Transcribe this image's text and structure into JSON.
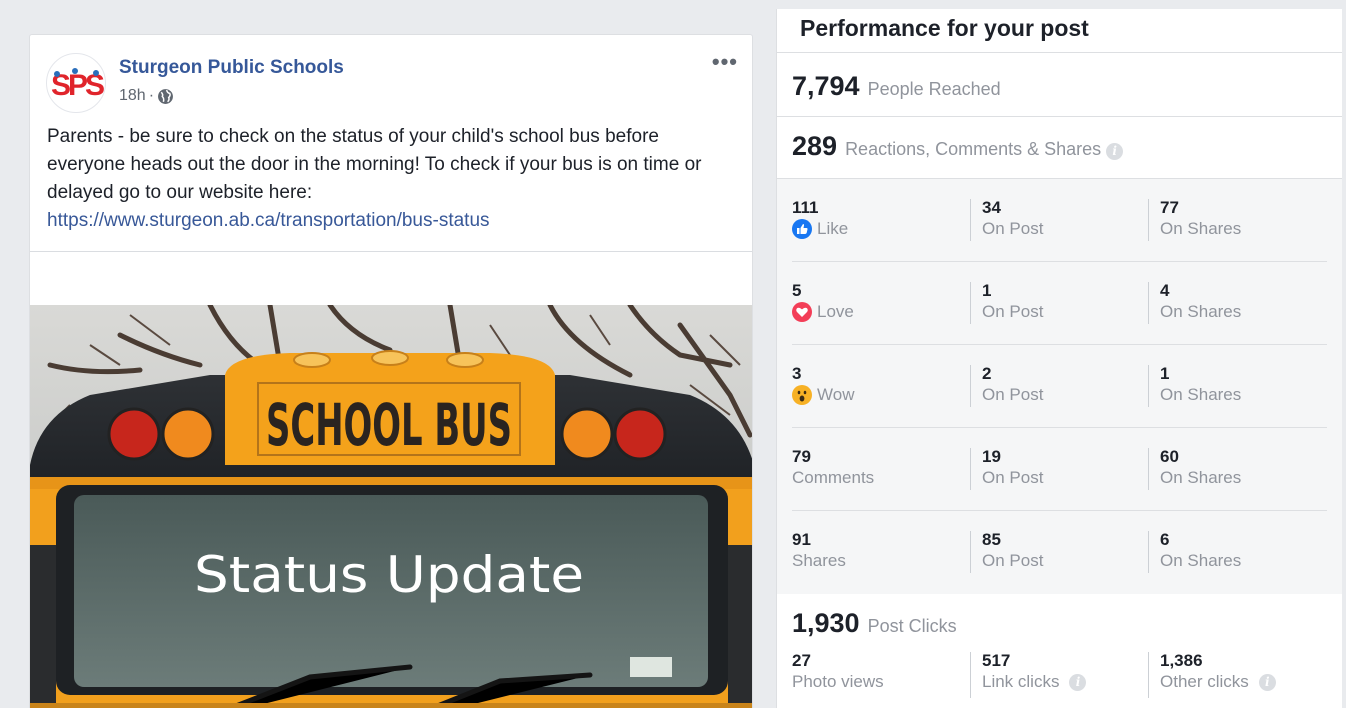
{
  "post": {
    "page_name": "Sturgeon Public Schools",
    "time": "18h",
    "separator": "·",
    "more": "•••",
    "text": "Parents - be sure to check on the status of your child's school bus before everyone heads out the door in the morning! To check if your bus is on time or delayed go to our website here:",
    "link": "https://www.sturgeon.ab.ca/transportation/bus-status",
    "image_sign": "SCHOOL BUS",
    "image_overlay": "Status Update",
    "avatar_text": "SPS"
  },
  "panel": {
    "title": "Performance for your post",
    "reach": {
      "value": "7,794",
      "label": "People Reached"
    },
    "reactions": {
      "value": "289",
      "label": "Reactions, Comments & Shares",
      "info": "i"
    },
    "rows": [
      {
        "total": "111",
        "label": "Like",
        "icon": "like-icon",
        "on_post": "34",
        "on_post_label": "On Post",
        "on_shares": "77",
        "on_shares_label": "On Shares"
      },
      {
        "total": "5",
        "label": "Love",
        "icon": "love-icon",
        "on_post": "1",
        "on_post_label": "On Post",
        "on_shares": "4",
        "on_shares_label": "On Shares"
      },
      {
        "total": "3",
        "label": "Wow",
        "icon": "wow-icon",
        "on_post": "2",
        "on_post_label": "On Post",
        "on_shares": "1",
        "on_shares_label": "On Shares"
      },
      {
        "total": "79",
        "label": "Comments",
        "icon": "",
        "on_post": "19",
        "on_post_label": "On Post",
        "on_shares": "60",
        "on_shares_label": "On Shares"
      },
      {
        "total": "91",
        "label": "Shares",
        "icon": "",
        "on_post": "85",
        "on_post_label": "On Post",
        "on_shares": "6",
        "on_shares_label": "On Shares"
      }
    ],
    "clicks": {
      "value": "1,930",
      "label": "Post Clicks"
    },
    "click_breakdown": [
      {
        "value": "27",
        "label": "Photo views",
        "info": ""
      },
      {
        "value": "517",
        "label": "Link clicks",
        "info": "i"
      },
      {
        "value": "1,386",
        "label": "Other clicks",
        "info": "i"
      }
    ]
  },
  "colors": {
    "link": "#385898",
    "page_name": "#365899",
    "like": "#1877f2",
    "love": "#f33e58",
    "wow": "#f7b125",
    "bus_yellow": "#f4a21b"
  }
}
